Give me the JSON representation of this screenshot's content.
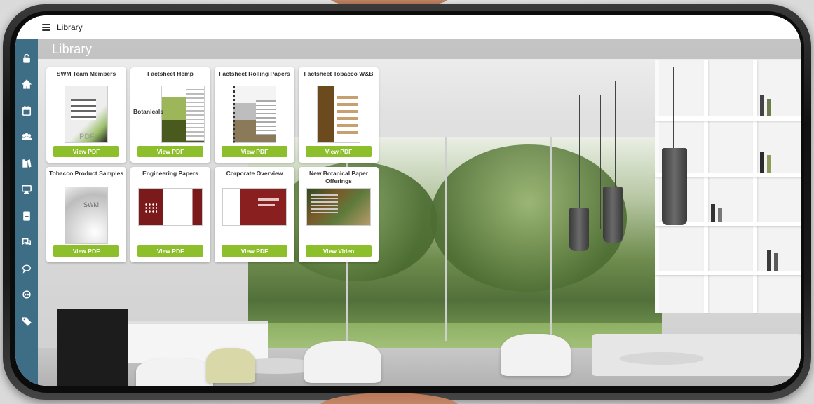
{
  "app": {
    "topbar_title": "Library",
    "page_title": "Library"
  },
  "sidebar": {
    "items": [
      {
        "icon": "lock-icon"
      },
      {
        "icon": "home-icon"
      },
      {
        "icon": "calendar-icon"
      },
      {
        "icon": "users-icon"
      },
      {
        "icon": "library-icon"
      },
      {
        "icon": "monitor-icon"
      },
      {
        "icon": "book-icon"
      },
      {
        "icon": "chat-icon"
      },
      {
        "icon": "comment-icon"
      },
      {
        "icon": "support-icon"
      },
      {
        "icon": "tag-icon"
      }
    ],
    "color": "#3d6e86"
  },
  "library": {
    "items": [
      {
        "title": "SWM Team Members",
        "thumb_text": "PDF",
        "button": "View PDF"
      },
      {
        "title": "Factsheet Hemp",
        "thumb_text": "Botanicals",
        "button": "View PDF"
      },
      {
        "title": "Factsheet Rolling Papers",
        "thumb_text": "",
        "button": "View PDF"
      },
      {
        "title": "Factsheet Tobacco W&B",
        "thumb_text": "",
        "button": "View PDF"
      },
      {
        "title": "Tobacco Product Samples",
        "thumb_text": "SWM",
        "button": "View PDF"
      },
      {
        "title": "Engineering Papers",
        "thumb_text": "",
        "button": "View PDF"
      },
      {
        "title": "Corporate Overview",
        "thumb_text": "",
        "button": "View PDF"
      },
      {
        "title": "New Botanical Paper Offerings",
        "thumb_text": "",
        "button": "View Video"
      }
    ],
    "button_color": "#8cbf2b"
  }
}
